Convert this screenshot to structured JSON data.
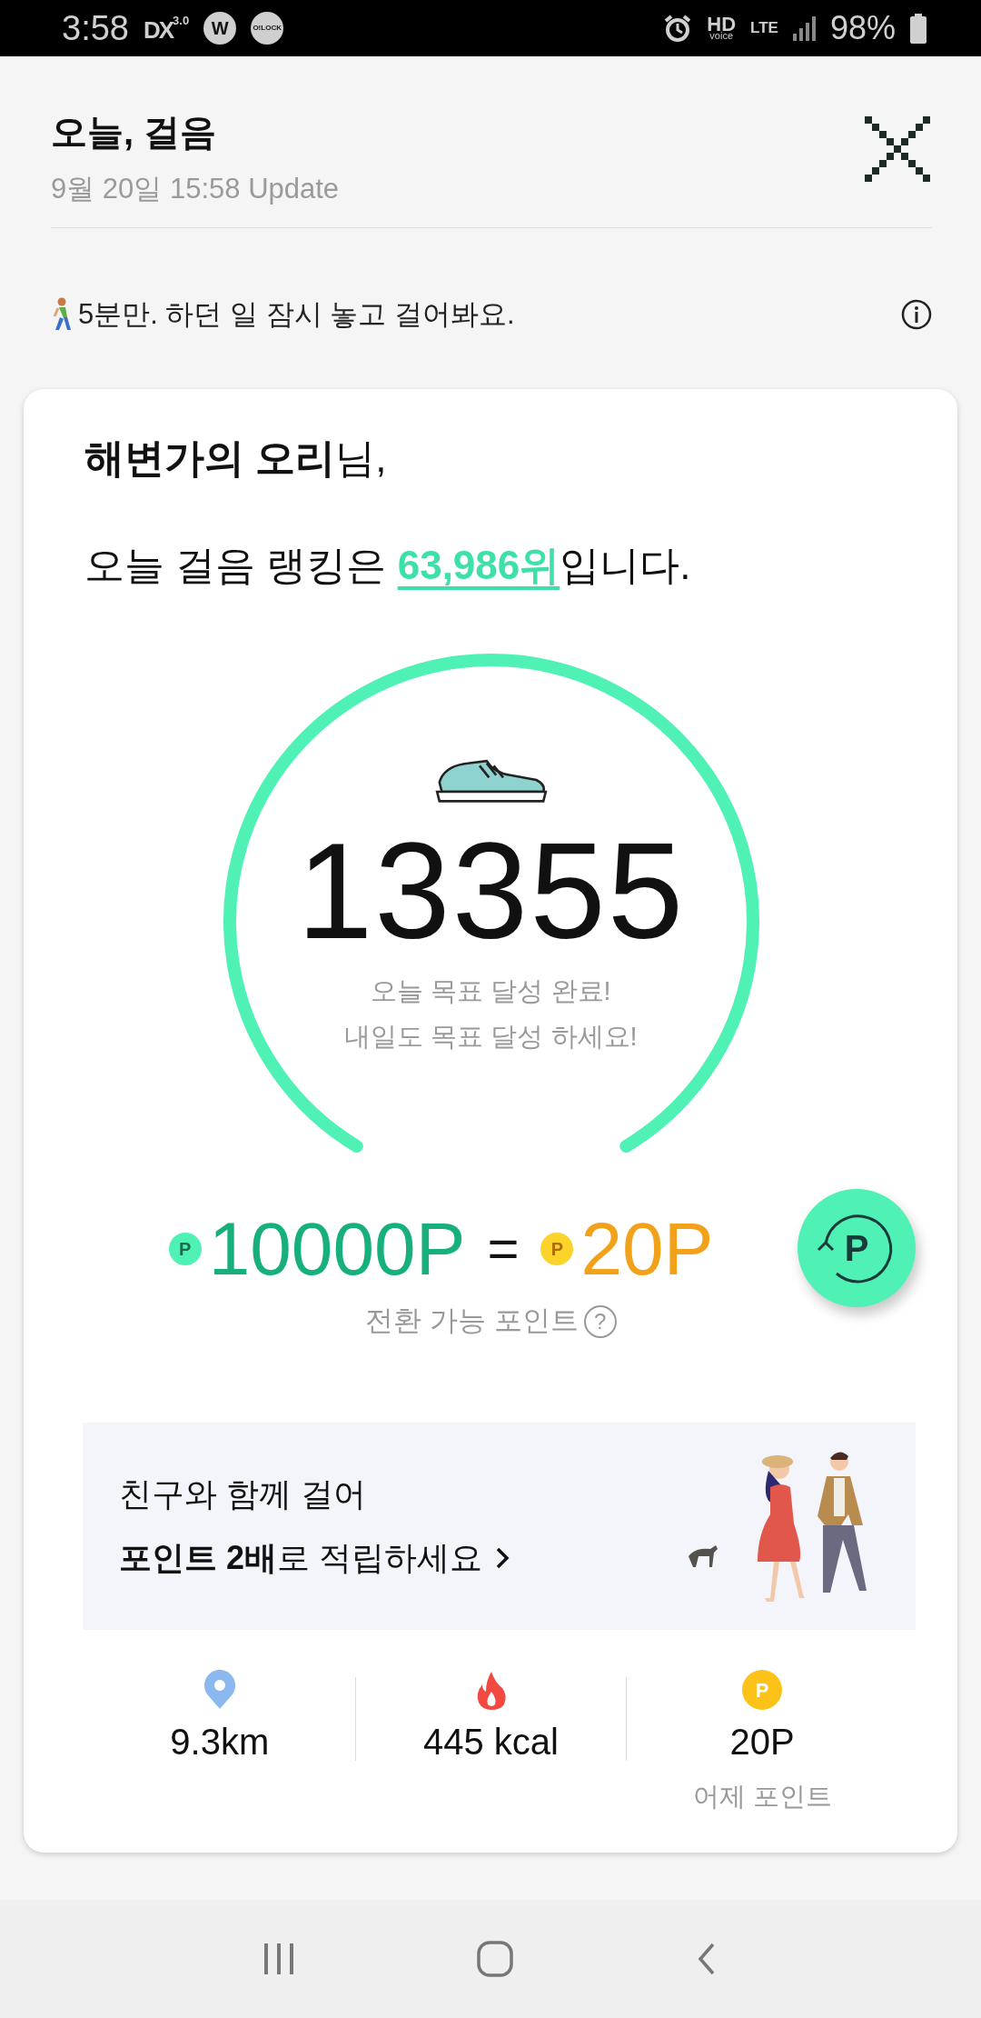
{
  "status_bar": {
    "time": "3:58",
    "app_icons": [
      {
        "kind": "dx",
        "label": "DX",
        "sup": "3.0"
      },
      {
        "kind": "circle",
        "label": "W"
      },
      {
        "kind": "circle_small",
        "label": "O!LOCK"
      }
    ],
    "hd": "HD",
    "hd_sub": "voice",
    "network": "LTE",
    "battery": "98%"
  },
  "header": {
    "title": "오늘, 걸음",
    "updated": "9월 20일 15:58 Update"
  },
  "tip": {
    "text": "5분만. 하던 일 잠시 놓고 걸어봐요."
  },
  "card": {
    "greeting": "**해변가의 오리**님,",
    "ranking_prefix": "오늘 걸음 랭킹은 ",
    "rank": "63,986위",
    "ranking_suffix": "입니다.",
    "steps": {
      "count": "13355",
      "messages": [
        "오늘 목표 달성 완료!",
        "내일도 목표 달성 하세요!"
      ]
    },
    "points": {
      "from": "10000P",
      "equals": "=",
      "to": "20P",
      "from_coin": "P",
      "to_coin": "P",
      "convert_label": "P",
      "help": "전환 가능 포인트",
      "help_icon": "?"
    },
    "banner": {
      "line1": "친구와 함께 걸어",
      "line2": "**포인트 2배**로 적립하세요"
    },
    "stats": [
      {
        "kind": "distance",
        "value": "9.3km"
      },
      {
        "kind": "calories",
        "value": "445 kcal"
      },
      {
        "kind": "points",
        "value": "20P",
        "coin": "P",
        "label": "어제 포인트"
      }
    ]
  }
}
